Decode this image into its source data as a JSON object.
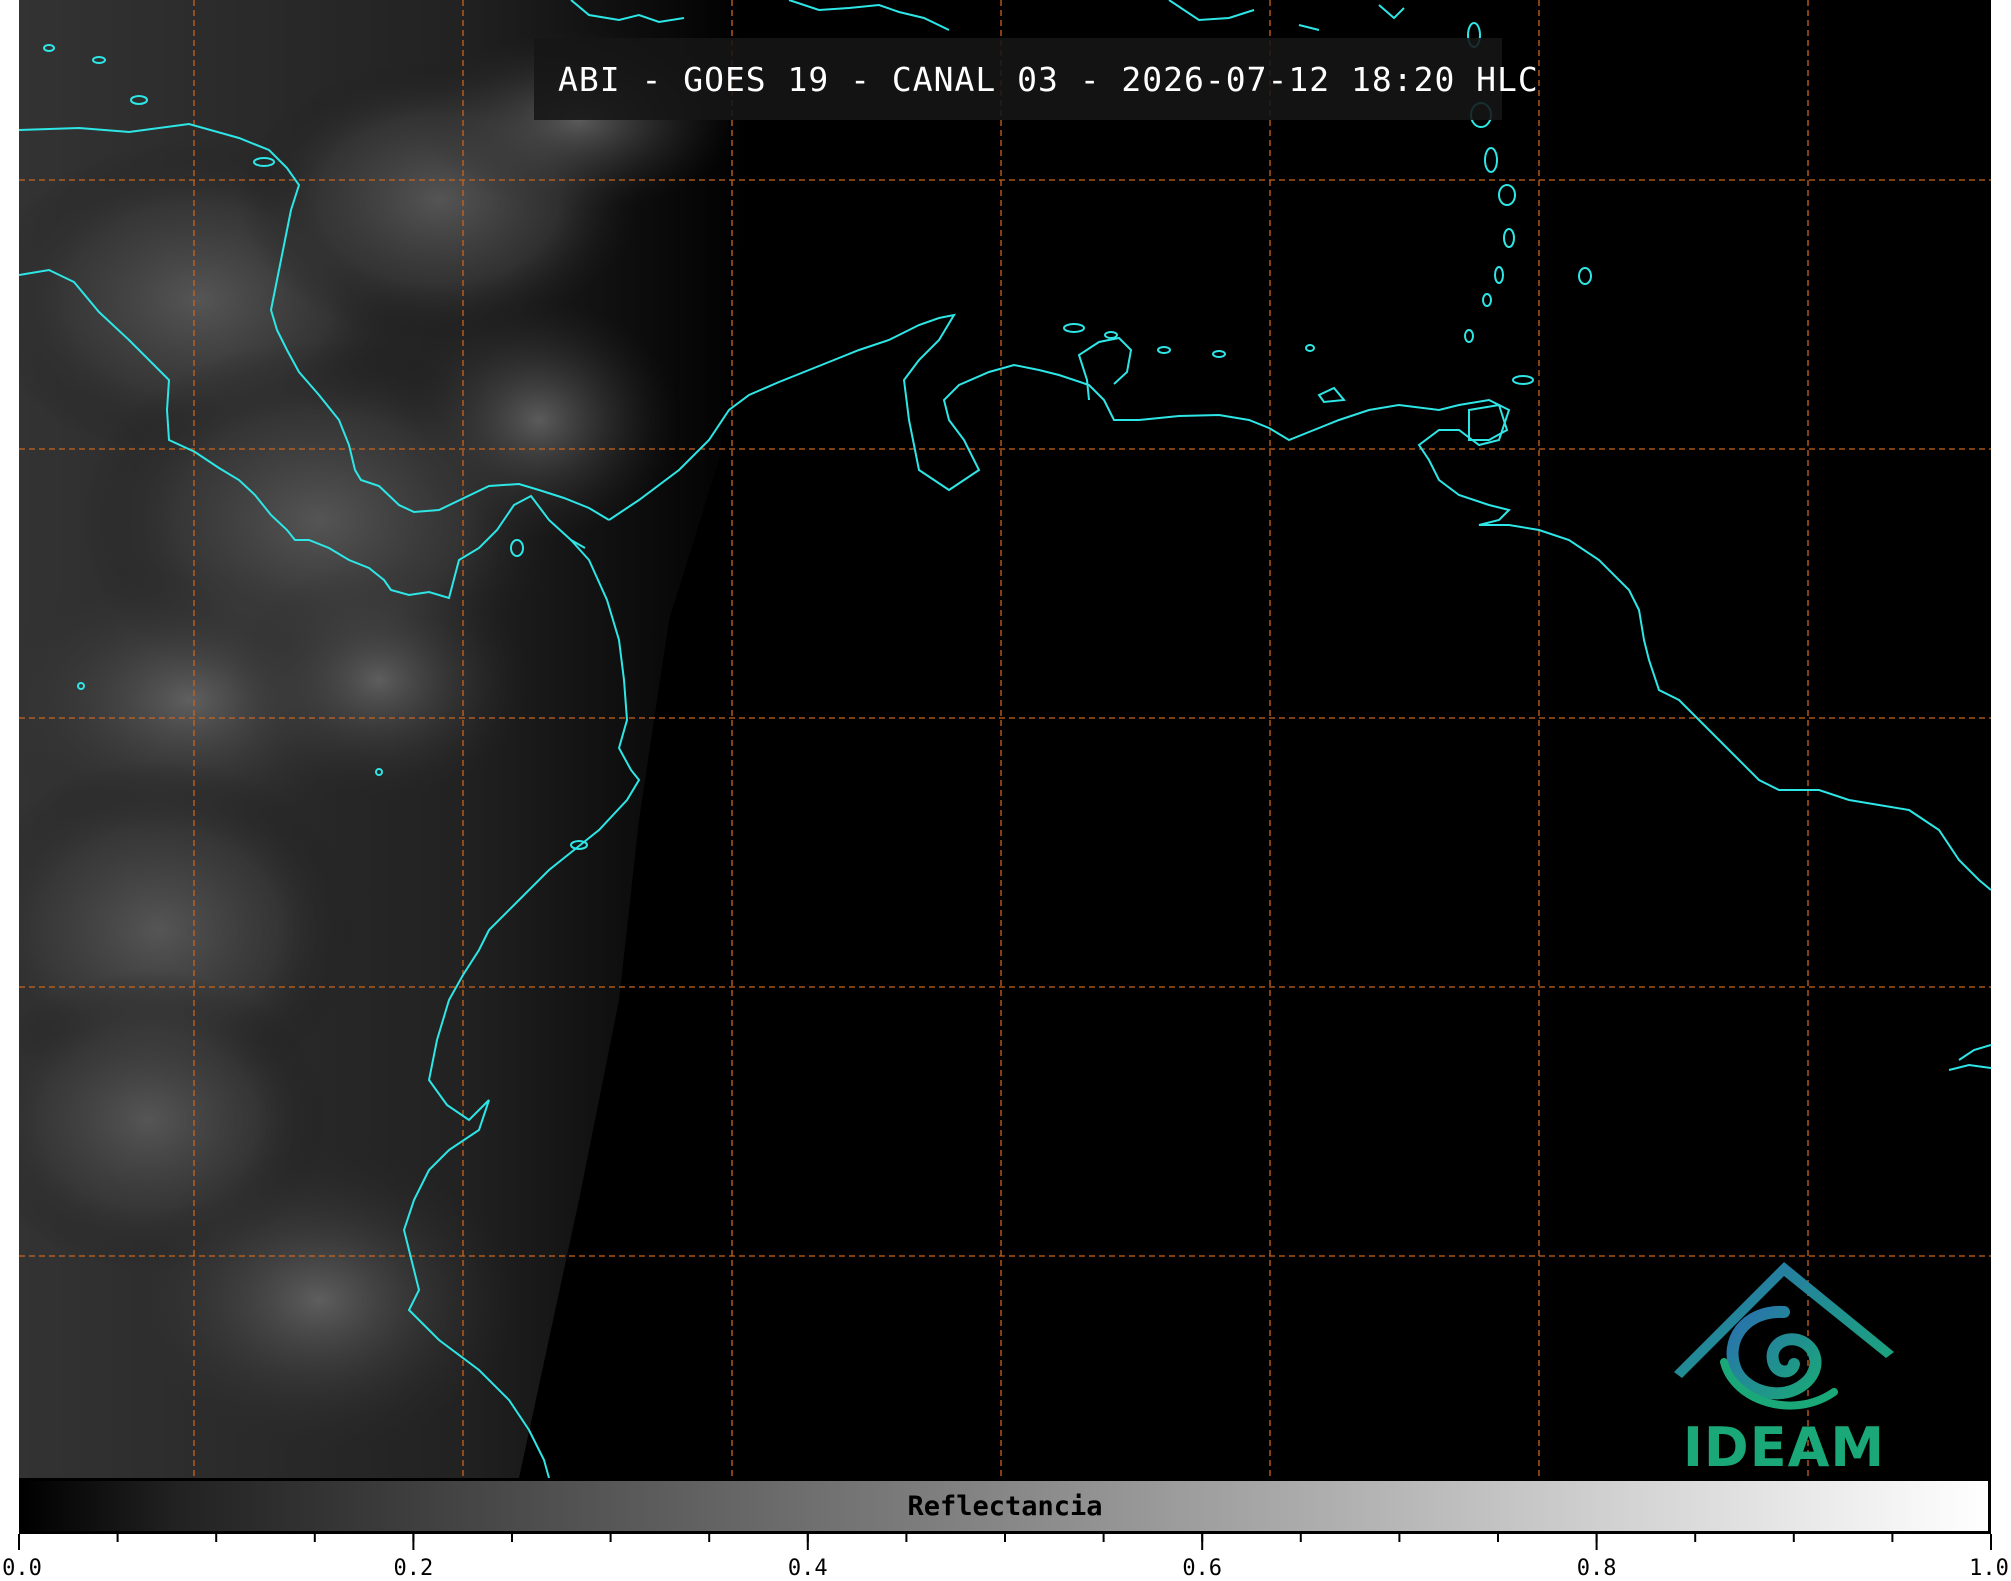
{
  "title": "ABI - GOES 19 - CANAL 03 - 2026-07-12 18:20 HLC",
  "colors": {
    "background": "#000000",
    "coastline": "#2ee6e6",
    "gridline": "#c8641e",
    "logo_blue": "#2a6fb0",
    "logo_green": "#1aa878"
  },
  "map": {
    "gridlines": "dashed orange",
    "coastline_color_name": "cyan",
    "cloud_region": "left (west)"
  },
  "logo": {
    "text": "IDEAM"
  },
  "colorbar": {
    "label": "Reflectancia",
    "range": [
      0.0,
      1.0
    ],
    "tick_labels": [
      "0.0",
      "0.2",
      "0.4",
      "0.6",
      "0.8",
      "1.0"
    ],
    "tick_values": [
      0.0,
      0.2,
      0.4,
      0.6,
      0.8,
      1.0
    ],
    "minor_ticks": 20
  }
}
